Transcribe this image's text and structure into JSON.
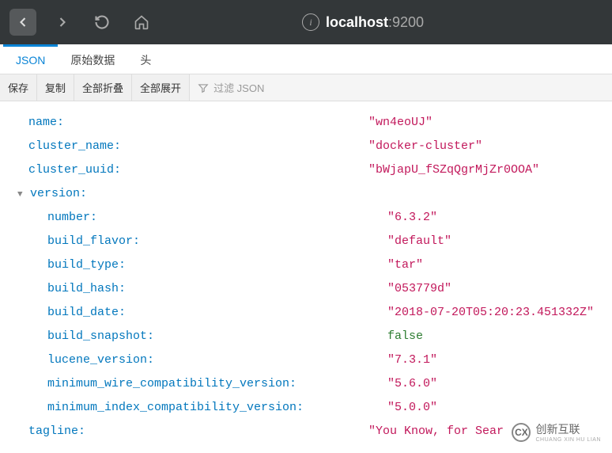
{
  "url": {
    "host": "localhost",
    "port": ":9200"
  },
  "tabs": [
    {
      "label": "JSON",
      "active": true
    },
    {
      "label": "原始数据",
      "active": false
    },
    {
      "label": "头",
      "active": false
    }
  ],
  "toolbar": {
    "save": "保存",
    "copy": "复制",
    "collapse_all": "全部折叠",
    "expand_all": "全部展开",
    "filter_placeholder": "过滤 JSON"
  },
  "json": {
    "name": {
      "key": "name:",
      "value": "\"wn4eoUJ\""
    },
    "cluster_name": {
      "key": "cluster_name:",
      "value": "\"docker-cluster\""
    },
    "cluster_uuid": {
      "key": "cluster_uuid:",
      "value": "\"bWjapU_fSZqQgrMjZr0OOA\""
    },
    "version": {
      "key": "version:",
      "number": {
        "key": "number:",
        "value": "\"6.3.2\""
      },
      "build_flavor": {
        "key": "build_flavor:",
        "value": "\"default\""
      },
      "build_type": {
        "key": "build_type:",
        "value": "\"tar\""
      },
      "build_hash": {
        "key": "build_hash:",
        "value": "\"053779d\""
      },
      "build_date": {
        "key": "build_date:",
        "value": "\"2018-07-20T05:20:23.451332Z\""
      },
      "build_snapshot": {
        "key": "build_snapshot:",
        "value": "false",
        "type": "bool"
      },
      "lucene_version": {
        "key": "lucene_version:",
        "value": "\"7.3.1\""
      },
      "minimum_wire_compatibility_version": {
        "key": "minimum_wire_compatibility_version:",
        "value": "\"5.6.0\""
      },
      "minimum_index_compatibility_version": {
        "key": "minimum_index_compatibility_version:",
        "value": "\"5.0.0\""
      }
    },
    "tagline": {
      "key": "tagline:",
      "value": "\"You Know, for Sear"
    }
  },
  "watermark": {
    "logo": "CX",
    "main": "创新互联",
    "sub": "CHUANG XIN HU LIAN"
  }
}
